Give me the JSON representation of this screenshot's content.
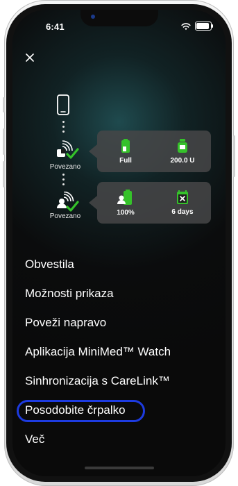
{
  "status_bar": {
    "time": "6:41"
  },
  "connections": [
    {
      "label": "Povezano",
      "stats": [
        {
          "value": "Full",
          "icon": "phone-battery-icon"
        },
        {
          "value": "200.0 U",
          "icon": "insulin-reservoir-icon"
        }
      ]
    },
    {
      "label": "Povezano",
      "stats": [
        {
          "value": "100%",
          "icon": "sensor-battery-icon"
        },
        {
          "value": "6 days",
          "icon": "sensor-calendar-icon"
        }
      ]
    }
  ],
  "menu": {
    "items": [
      "Obvestila",
      "Možnosti prikaza",
      "Poveži napravo",
      "Aplikacija MiniMed™ Watch",
      "Sinhronizacija s CareLink™",
      "Posodobite črpalko",
      "Več"
    ],
    "highlighted_index": 5
  },
  "colors": {
    "accent_green": "#35c22a",
    "highlight_blue": "#1d3be0",
    "card_bg": "#464648"
  }
}
